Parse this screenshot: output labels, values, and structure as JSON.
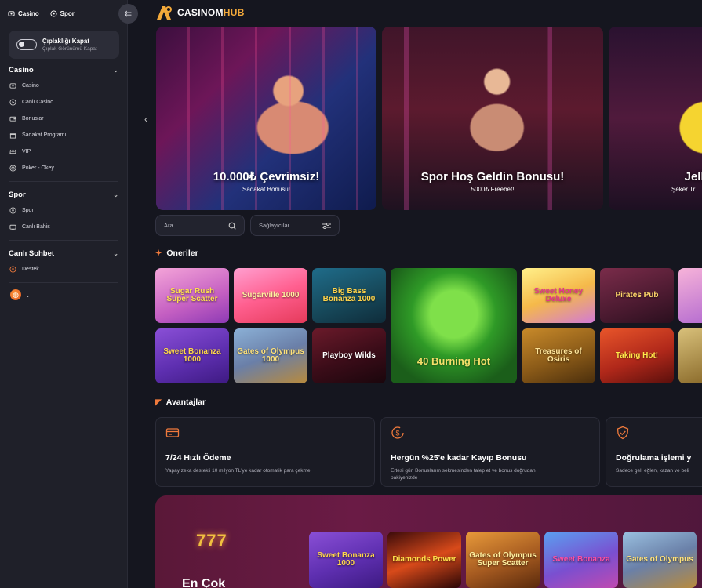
{
  "sidebar": {
    "tabs": [
      {
        "label": "Casino",
        "icon": "casino-icon"
      },
      {
        "label": "Spor",
        "icon": "soccer-ball-icon"
      }
    ],
    "nudity": {
      "title": "Çıplaklığı Kapat",
      "subtitle": "Çıplak Görünümü Kapat"
    },
    "sections": [
      {
        "title": "Casino",
        "items": [
          {
            "label": "Casino",
            "icon": "casino-icon"
          },
          {
            "label": "Canlı Casino",
            "icon": "play-icon"
          },
          {
            "label": "Bonuslar",
            "icon": "wallet-icon"
          },
          {
            "label": "Sadakat Programı",
            "icon": "gift-icon"
          },
          {
            "label": "VIP",
            "icon": "crown-icon"
          },
          {
            "label": "Poker - Okey",
            "icon": "chip-icon"
          }
        ]
      },
      {
        "title": "Spor",
        "items": [
          {
            "label": "Spor",
            "icon": "soccer-ball-icon"
          },
          {
            "label": "Canlı Bahis",
            "icon": "live-tv-icon"
          }
        ]
      },
      {
        "title": "Canlı Sohbet",
        "items": [
          {
            "label": "Destek",
            "icon": "support-icon"
          }
        ]
      }
    ]
  },
  "logo": {
    "part1": "CASINOM",
    "part2": "HUB"
  },
  "banners": [
    {
      "title": "10.000₺ Çevrimsiz!",
      "subtitle": "Sadakat Bonusu!"
    },
    {
      "title": "Spor Hoş Geldin Bonusu!",
      "subtitle": "5000₺ Freebet!"
    },
    {
      "title": "Jelly",
      "subtitle": "Şeker Tr"
    }
  ],
  "search": {
    "placeholder": "Ara",
    "providers": "Sağlayıcılar"
  },
  "recommendations": {
    "title": "Öneriler",
    "games": [
      "Sugar Rush Super Scatter",
      "Sugarville 1000",
      "Big Bass Bonanza 1000",
      "40 Burning Hot",
      "Sweet Honey Deluxe",
      "Pirates Pub",
      "Sweet Bonanza 1000",
      "Gates of Olympus 1000",
      "Playboy Wilds",
      "Treasures of Osiris",
      "Taking Hot!"
    ]
  },
  "advantages": {
    "title": "Avantajlar",
    "items": [
      {
        "title": "7/24 Hızlı Ödeme",
        "desc": "Yapay zeka destekli 10 milyon TL'ye kadar otomatik para çekme",
        "icon": "card-icon"
      },
      {
        "title": "Hergün %25'e kadar Kayıp Bonusu",
        "desc": "Ertesi gün Bonuslarım sekmesinden talep et ve bonus doğrudan\nbakiyenizde",
        "icon": "money-back-icon"
      },
      {
        "title": "Doğrulama işlemi y",
        "desc": "Sadece gel, eğlen, kazan ve beli",
        "icon": "shield-check-icon"
      }
    ]
  },
  "promo": {
    "slot": "777",
    "title": "En Çok",
    "games": [
      "Sweet Bonanza 1000",
      "Diamonds Power",
      "Gates of Olympus Super Scatter",
      "Sweet Bonanza",
      "Gates of Olympus"
    ]
  },
  "colors": {
    "accent": "#f07a3c",
    "background": "#15161f",
    "sidebar": "#1f2029"
  }
}
